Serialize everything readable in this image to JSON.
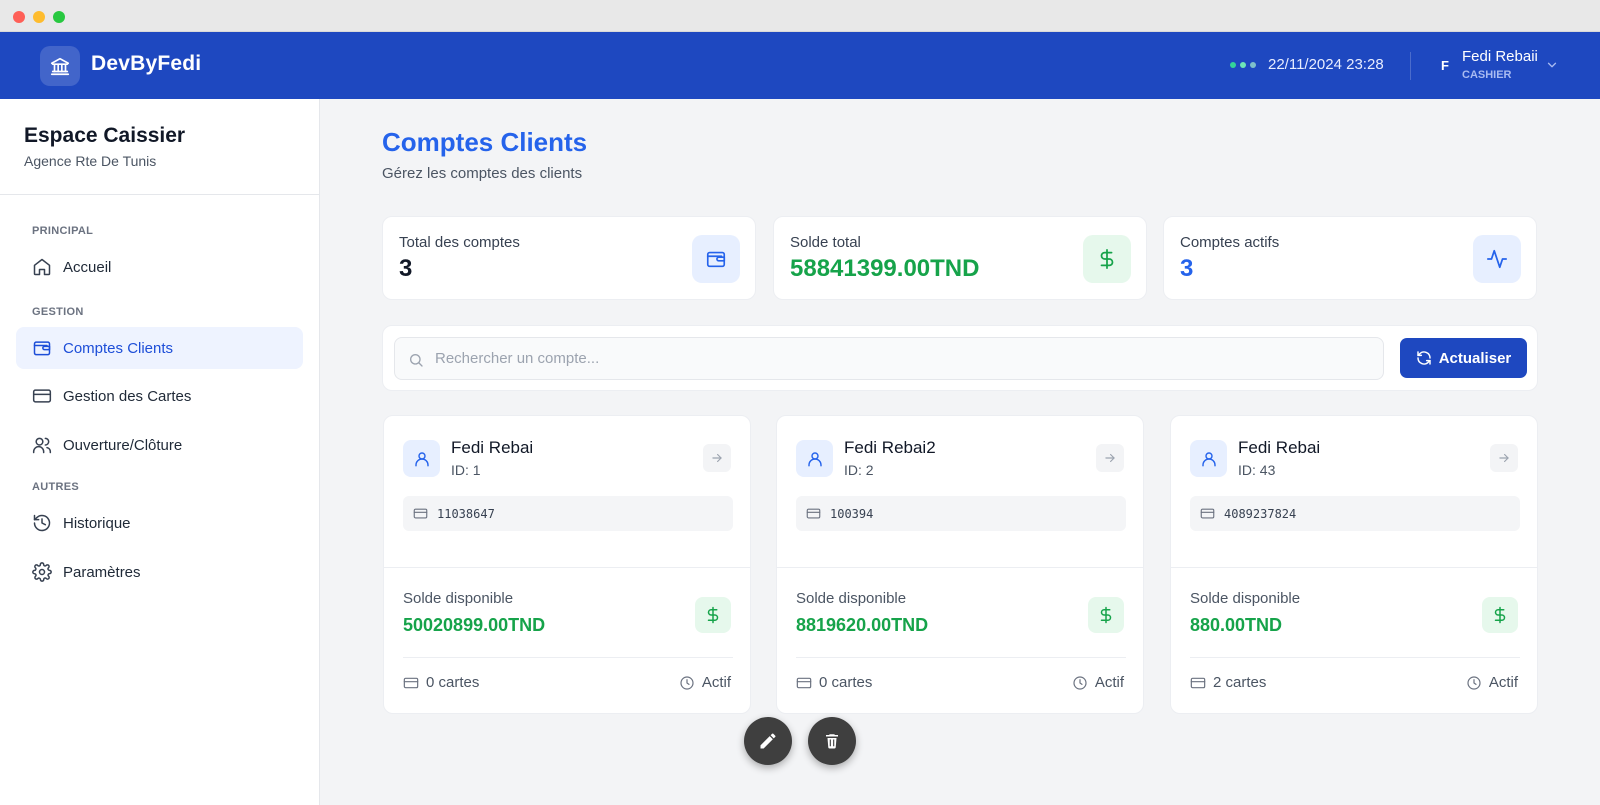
{
  "header": {
    "brand": "DevByFedi",
    "datetime": "22/11/2024 23:28",
    "user_initial": "F",
    "user_name": "Fedi Rebaii",
    "user_role": "CASHIER"
  },
  "sidebar": {
    "title": "Espace Caissier",
    "subtitle": "Agence Rte De Tunis",
    "sections": [
      "PRINCIPAL",
      "GESTION",
      "AUTRES"
    ],
    "items": [
      {
        "label": "Accueil",
        "icon": "home-icon"
      },
      {
        "label": "Comptes Clients",
        "icon": "wallet-icon",
        "active": true
      },
      {
        "label": "Gestion des Cartes",
        "icon": "credit-card-icon"
      },
      {
        "label": "Ouverture/Clôture",
        "icon": "users-icon"
      },
      {
        "label": "Historique",
        "icon": "history-icon"
      },
      {
        "label": "Paramètres",
        "icon": "settings-icon"
      }
    ]
  },
  "page": {
    "title": "Comptes Clients",
    "subtitle": "Gérez les comptes des clients"
  },
  "stats": [
    {
      "label": "Total des comptes",
      "value": "3",
      "icon": "wallet-icon"
    },
    {
      "label": "Solde total",
      "value": "58841399.00TND",
      "icon": "dollar-icon"
    },
    {
      "label": "Comptes actifs",
      "value": "3",
      "icon": "activity-icon"
    }
  ],
  "search": {
    "placeholder": "Rechercher un compte...",
    "refresh_label": "Actualiser"
  },
  "accounts": [
    {
      "name": "Fedi Rebai",
      "id": "ID: 1",
      "number": "11038647",
      "balance_label": "Solde disponible",
      "balance": "50020899.00TND",
      "cards": "0 cartes",
      "status": "Actif"
    },
    {
      "name": "Fedi Rebai2",
      "id": "ID: 2",
      "number": "100394",
      "balance_label": "Solde disponible",
      "balance": "8819620.00TND",
      "cards": "0 cartes",
      "status": "Actif"
    },
    {
      "name": "Fedi Rebai",
      "id": "ID: 43",
      "number": "4089237824",
      "balance_label": "Solde disponible",
      "balance": "880.00TND",
      "cards": "2 cartes",
      "status": "Actif"
    }
  ],
  "colors": {
    "primary": "#1e48c0",
    "accent_blue": "#2563eb",
    "money_green": "#16a34a"
  }
}
